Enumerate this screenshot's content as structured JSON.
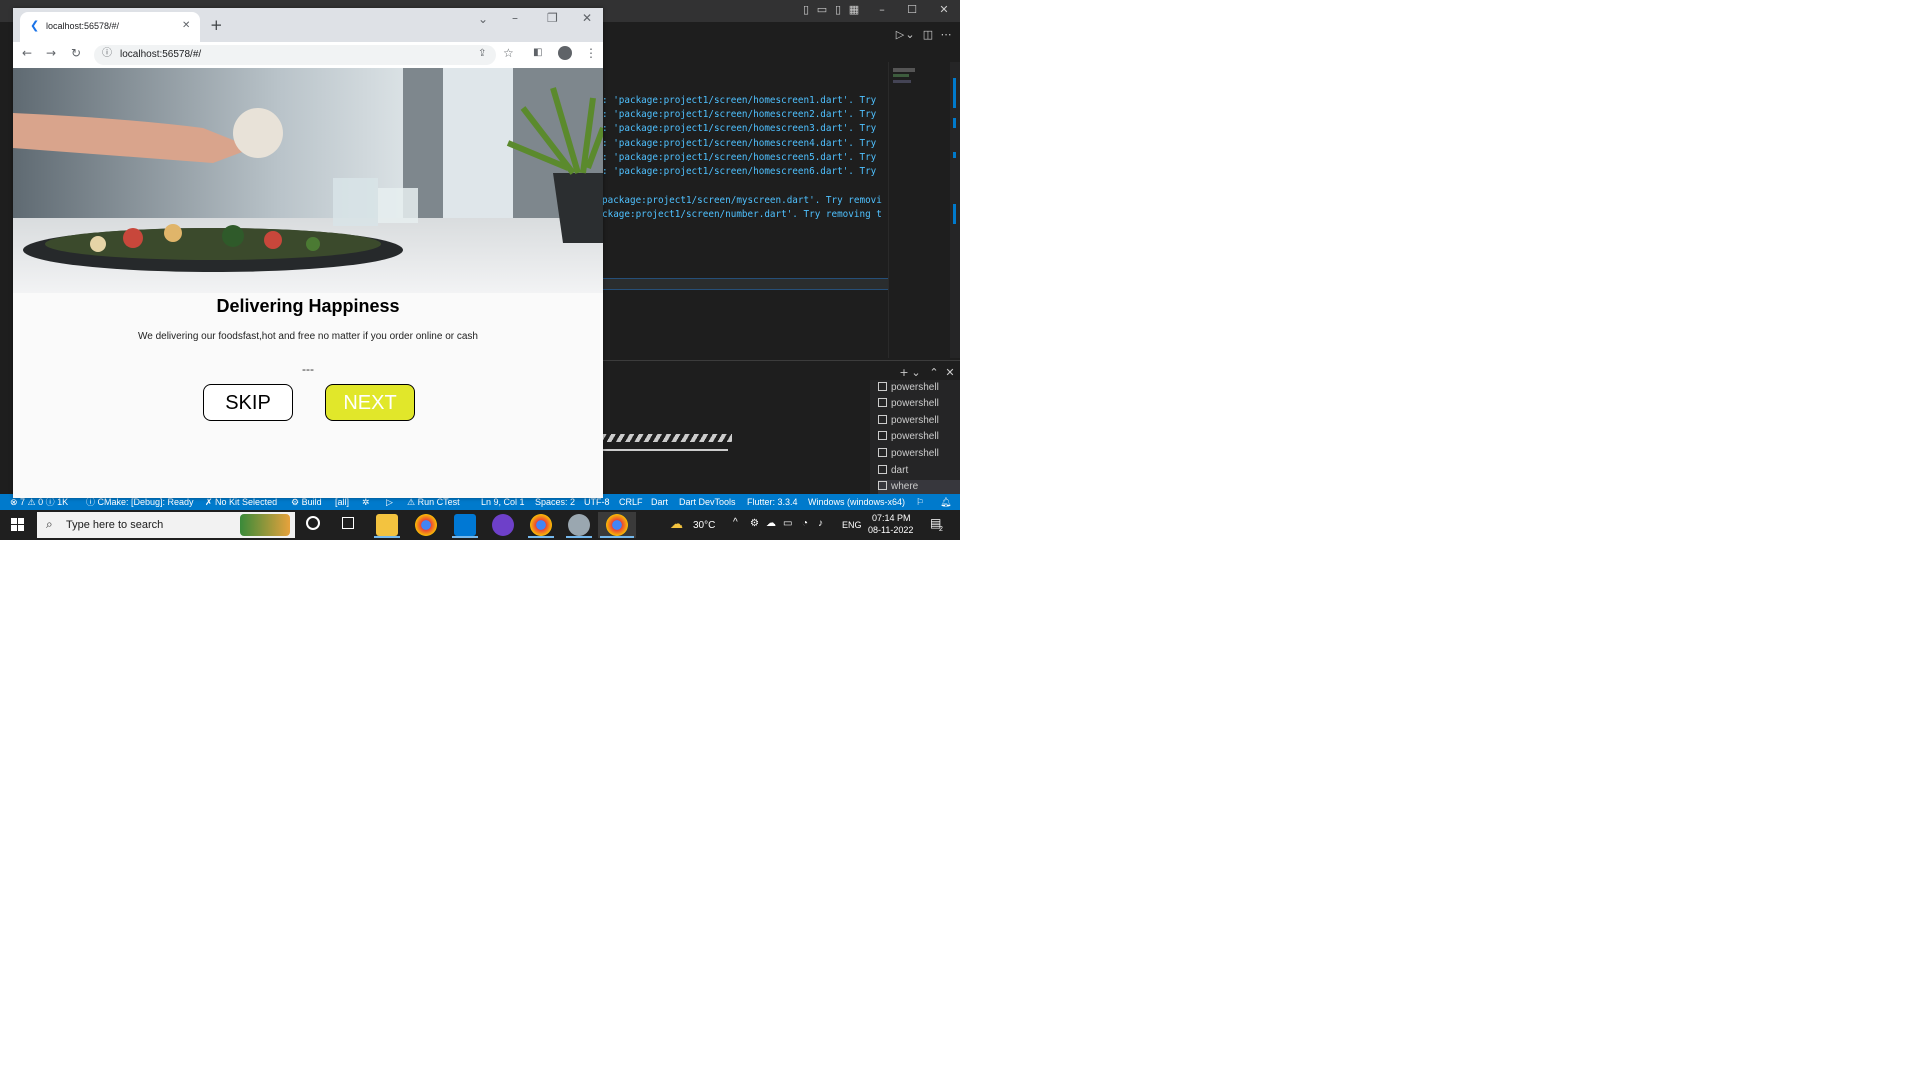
{
  "browser": {
    "tab_title": "localhost:56578/#/",
    "url": "localhost:56578/#/"
  },
  "page": {
    "heading": "Delivering Happiness",
    "subtitle": "We delivering our foodsfast,hot and free no matter if you order online or cash",
    "indicator": "---",
    "skip_label": "SKIP",
    "next_label": "NEXT",
    "next_color": "#e1e72a"
  },
  "editor": {
    "output_lines": [
      ": 'package:project1/screen/homescreen1.dart'. Try",
      ": 'package:project1/screen/homescreen2.dart'. Try",
      ": 'package:project1/screen/homescreen3.dart'. Try",
      ": 'package:project1/screen/homescreen4.dart'. Try",
      ": 'package:project1/screen/homescreen5.dart'. Try",
      ": 'package:project1/screen/homescreen6.dart'. Try",
      "package:project1/screen/myscreen.dart'. Try removi",
      "ckage:project1/screen/number.dart'. Try removing t"
    ],
    "text_color": "#4fc1ff"
  },
  "terminals": [
    "powershell",
    "powershell",
    "powershell",
    "powershell",
    "powershell",
    "dart",
    "where"
  ],
  "statusbar": {
    "problems": "⊗ 7 ⚠ 0 ⓘ 1K",
    "cmake": "ⓘ CMake: [Debug]: Ready",
    "kit": "✗ No Kit Selected",
    "build": "⚙ Build",
    "all": "[all]",
    "ctest": "⚠ Run CTest",
    "position": "Ln 9, Col 1",
    "spaces": "Spaces: 2",
    "encoding": "UTF-8",
    "eol": "CRLF",
    "language": "Dart",
    "devtools": "Dart DevTools",
    "flutter": "Flutter: 3.3.4",
    "device": "Windows (windows-x64)",
    "accent": "#007acc"
  },
  "taskbar": {
    "search_placeholder": "Type here to search",
    "weather": "30°C",
    "lang": "ENG",
    "time": "07:14 PM",
    "date": "08-11-2022",
    "notifications": "2"
  }
}
